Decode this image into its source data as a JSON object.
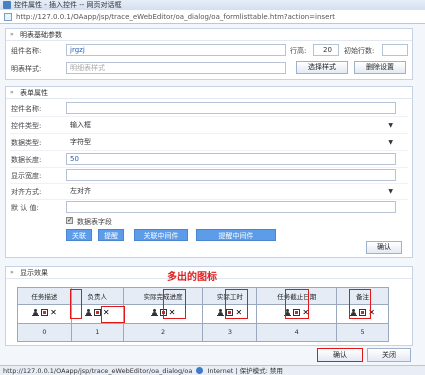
{
  "window": {
    "title": "控件属性 - 插入控件 -- 网页对话框",
    "address": "http://127.0.0.1/OAapp/jsp/trace_eWebEditor/oa_dialog/oa_formlisttable.htm?action=insert"
  },
  "basic": {
    "heading": "明表基础参数",
    "name_label": "组件名称:",
    "name_value": "jrgzj",
    "rows_label": "行高:",
    "rows_value": "20",
    "init_rows_label": "初始行数:",
    "init_rows_value": "",
    "style_label": "明表样式:",
    "style_placeholder": "明细表样式",
    "select_style_btn": "选择样式",
    "delete_setting_btn": "删除设置"
  },
  "props": {
    "heading": "表单属性",
    "control_name_label": "控件名称:",
    "control_name_value": "",
    "control_type_label": "控件类型:",
    "control_type_value": "输入框",
    "data_type_label": "数据类型:",
    "data_type_value": "字符型",
    "data_length_label": "数据长度:",
    "data_length_value": "50",
    "display_width_label": "显示宽度:",
    "display_width_value": "",
    "align_label": "对齐方式:",
    "align_value": "左对齐",
    "default_label": "默 认 值:",
    "default_value": "",
    "checkbox_label": "数据表字段",
    "btn_link": "关联",
    "btn_remind": "提醒",
    "btn_link_mid": "关联中间件",
    "btn_remind_mid": "提醒中间件",
    "confirm_btn": "确认"
  },
  "preview": {
    "heading": "显示效果",
    "annotation": "多出的图标",
    "columns": [
      "任务描述",
      "负责人",
      "实际完成进度",
      "实际工时",
      "任务截止日期",
      "备注"
    ],
    "index": [
      "0",
      "1",
      "2",
      "3",
      "4",
      "5"
    ]
  },
  "footer": {
    "ok_btn": "确认",
    "close_btn": "关闭"
  },
  "status": {
    "url": "http://127.0.0.1/OAapp/jsp/trace_eWebEditor/oa_dialog/oa",
    "zone": "Internet | 保护模式: 禁用"
  }
}
